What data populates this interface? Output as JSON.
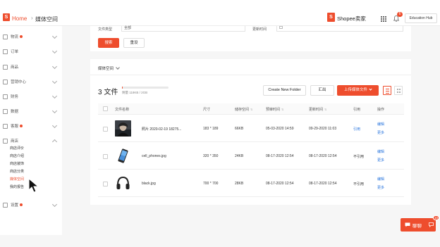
{
  "header": {
    "home_label": "Home",
    "breadcrumb_sep": "›",
    "breadcrumb_current": "媒体空间",
    "brand_text": "Shopee卖家",
    "notification_count": "6",
    "edu_hub_label": "Education Hub",
    "accent_color": "#ee4d2d"
  },
  "sidebar": {
    "items": [
      {
        "label": "物流",
        "icon": "truck-icon",
        "dot": true
      },
      {
        "label": "订单",
        "icon": "order-icon",
        "dot": false
      },
      {
        "label": "商品",
        "icon": "product-icon",
        "dot": false
      },
      {
        "label": "营销中心",
        "icon": "marketing-icon",
        "dot": false
      },
      {
        "label": "财务",
        "icon": "finance-icon",
        "dot": false
      },
      {
        "label": "数据",
        "icon": "data-icon",
        "dot": false
      },
      {
        "label": "客服",
        "icon": "customer-service-icon",
        "dot": true
      },
      {
        "label": "商店",
        "icon": "shop-icon",
        "dot": false
      },
      {
        "label": "设置",
        "icon": "settings-icon",
        "dot": true
      }
    ],
    "shop_sub": [
      "商店评价",
      "商店介绍",
      "商店装饰",
      "商店分类",
      "媒体空间",
      "我的报告"
    ],
    "active_sub": "媒体空间"
  },
  "filters": {
    "file_type_label": "文件类型",
    "file_type_value": "全部",
    "update_time_label": "更新时间",
    "search_button": "搜索",
    "reset_button": "重设"
  },
  "main": {
    "space_dropdown": "媒体空间",
    "file_count": "3 文件",
    "quota_text": "剩量 118KB / 2GB",
    "quota_fraction": 0.0001,
    "new_folder_button": "Create New Folder",
    "export_button": "汇出",
    "upload_button": "上传媒体文件"
  },
  "table": {
    "columns": [
      "文件名称",
      "尺寸",
      "储存空间",
      "预审时间",
      "更新时间",
      "引用",
      "操作"
    ],
    "rows": [
      {
        "name": "照片 2020-02-19 18275...",
        "size": "183 * 189",
        "storage": "66KB",
        "preview_time": "05-03-2020 14:59",
        "update_time": "09-29-2020 11:03",
        "reference": "引用",
        "ref_link": true,
        "actions": [
          "编辑",
          "更多"
        ],
        "thumb": "portrait"
      },
      {
        "name": "cell_phones.jpg",
        "size": "320 * 350",
        "storage": "24KB",
        "preview_time": "08-17-2020 12:54",
        "update_time": "08-17-2020 12:54",
        "reference": "不引用",
        "ref_link": false,
        "actions": [
          "编辑",
          "更多"
        ],
        "thumb": "phone"
      },
      {
        "name": "black.jpg",
        "size": "700 * 700",
        "storage": "28KB",
        "preview_time": "08-17-2020 12:54",
        "update_time": "08-17-2020 12:54",
        "reference": "不引用",
        "ref_link": false,
        "actions": [
          "编辑",
          "更多"
        ],
        "thumb": "headphones"
      }
    ]
  },
  "chat": {
    "label": "聊聊",
    "badge": "10"
  }
}
